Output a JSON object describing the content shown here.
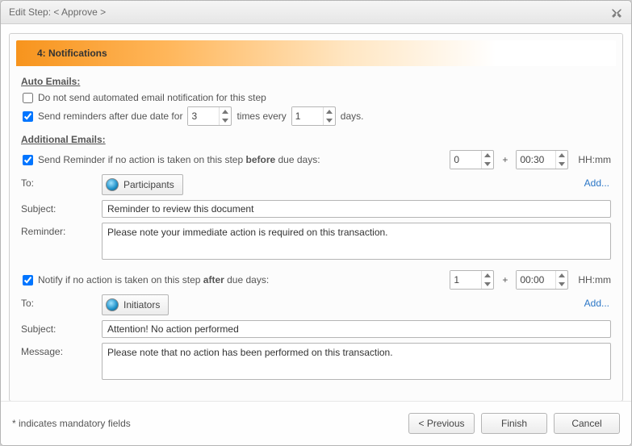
{
  "window": {
    "title": "Edit Step: < Approve >"
  },
  "section": {
    "header": "4: Notifications"
  },
  "auto_emails": {
    "heading": "Auto Emails:",
    "no_auto_label": "Do not send automated email notification for this step",
    "no_auto_checked": false,
    "send_reminders_checked": true,
    "send_reminders_prefix": "Send reminders after due date for",
    "send_reminders_times_value": "3",
    "send_reminders_mid": "times every",
    "send_reminders_every_value": "1",
    "send_reminders_suffix": "days."
  },
  "additional_emails": {
    "heading": "Additional Emails:",
    "before": {
      "checked": true,
      "label_prefix": "Send Reminder if no action is taken on this step ",
      "label_bold": "before",
      "label_suffix": " due days:",
      "days_value": "0",
      "plus": "+",
      "time_value": "00:30",
      "time_unit": "HH:mm",
      "to_label": "To:",
      "to_chip": "Participants",
      "add_label": "Add...",
      "subject_label": "Subject:",
      "subject_value": "Reminder to review this document",
      "body_label": "Reminder:",
      "body_value": "Please note your immediate action is required on this transaction."
    },
    "after": {
      "checked": true,
      "label_prefix": "Notify if no action is taken on this step ",
      "label_bold": "after",
      "label_suffix": " due days:",
      "days_value": "1",
      "plus": "+",
      "time_value": "00:00",
      "time_unit": "HH:mm",
      "to_label": "To:",
      "to_chip": "Initiators",
      "add_label": "Add...",
      "subject_label": "Subject:",
      "subject_value": "Attention! No action performed",
      "body_label": "Message:",
      "body_value": "Please note that no action has been performed on this transaction."
    }
  },
  "footer": {
    "note": "* indicates mandatory fields",
    "previous": "< Previous",
    "finish": "Finish",
    "cancel": "Cancel"
  }
}
